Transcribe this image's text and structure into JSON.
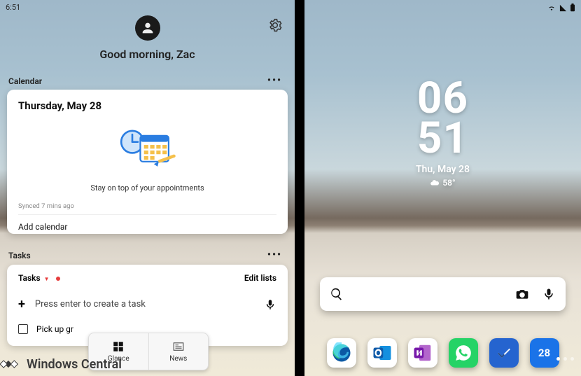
{
  "left": {
    "status_time": "6:51",
    "greeting": "Good morning, Zac",
    "calendar": {
      "section": "Calendar",
      "date": "Thursday, May 28",
      "message": "Stay on top of your appointments",
      "sync": "Synced 7 mins ago",
      "add": "Add calendar"
    },
    "tasks": {
      "section": "Tasks",
      "list_name": "Tasks",
      "edit": "Edit lists",
      "placeholder": "Press enter to create a task",
      "item1": "Pick up gr"
    },
    "nav": {
      "glance": "Glance",
      "news": "News"
    }
  },
  "right": {
    "clock_h": "06",
    "clock_m": "51",
    "date": "Thu, May 28",
    "temp": "58°",
    "calendar_day": "28"
  },
  "watermark": "Windows Central"
}
